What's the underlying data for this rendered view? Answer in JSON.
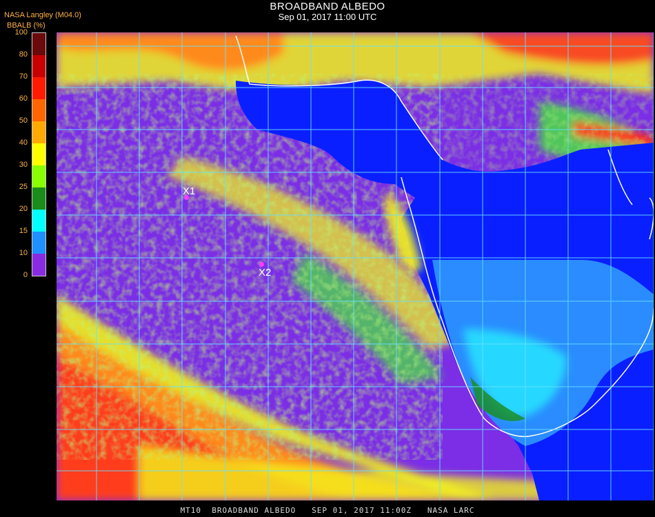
{
  "header": {
    "title": "BROADBAND ALBEDO",
    "datetime": "Sep 01, 2017 11:00 UTC",
    "provider": "NASA Langley (M04.0)",
    "unit_label": "BBALB (%)"
  },
  "colorbar": {
    "ticks": [
      "100",
      "80",
      "70",
      "60",
      "50",
      "40",
      "30",
      "25",
      "20",
      "15",
      "10",
      "0"
    ],
    "colors": [
      "#6b0a0a",
      "#c80000",
      "#ff1a00",
      "#ff6600",
      "#ffaa00",
      "#ffff00",
      "#88ff00",
      "#1a8c1a",
      "#00ffff",
      "#1e90ff",
      "#0000ff",
      "#8a2be2"
    ]
  },
  "map": {
    "colors": {
      "ocean": "#7b2ee6",
      "grid": "#66e0ff",
      "coast": "#ffffff",
      "low_cloud": "#1030ff",
      "mid_cloud": "#28c8ff",
      "green": "#4cd64c",
      "yellow": "#f2f21a",
      "orange": "#ff8a1a",
      "red": "#ff2a1a"
    },
    "markers": [
      {
        "label": "X1"
      },
      {
        "label": "X2"
      }
    ]
  },
  "footer": "MT10  BROADBAND ALBEDO   SEP 01, 2017 11:00Z   NASA LARC"
}
